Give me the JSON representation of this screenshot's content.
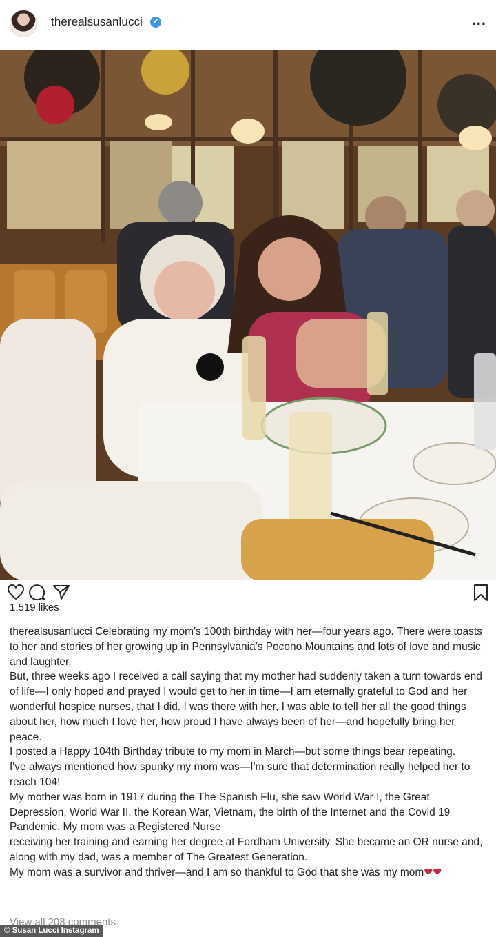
{
  "header": {
    "username": "therealsusanlucci",
    "verified_badge": "✔",
    "more_label": "..."
  },
  "post": {
    "likes": "1,519 likes",
    "caption_user": "therealsusanlucci",
    "caption_paragraphs": [
      "Celebrating my mom's 100th birthday with her—four years ago. There were toasts to her and stories of her growing up in Pennsylvania's Pocono Mountains and lots of love and music and laughter.",
      "But, three weeks ago I received a call saying that my mother had suddenly taken a turn towards end of life—I only hoped and prayed I would get to her in time—I am eternally grateful to God and her wonderful hospice nurses, that I did. I was there with her, I was able to tell her all the good things about her, how much I love her, how proud I have always been of her—and hopefully bring her peace.",
      "I posted a Happy 104th Birthday tribute to my mom in March—but some things bear repeating.",
      "I've always mentioned how spunky my mom was—I'm sure that determination really helped her to reach 104!",
      "My mother was born in 1917 during the The Spanish Flu, she saw World War I, the Great Depression, World War II, the Korean War, Vietnam, the birth of the Internet and the Covid 19 Pandemic. My mom was a Registered Nurse",
      "receiving her training and earning her degree at Fordham University. She became an OR nurse and, along with my dad, was a member of The Greatest Generation.",
      "My mom was a survivor and thriver—and I am so thankful to God that she was my mom"
    ],
    "caption_hearts": "❤❤",
    "view_comments": "View all 208 comments"
  },
  "credit": "© Susan Lucci Instagram",
  "icons": {
    "like": "heart-outline-icon",
    "comment": "comment-bubble-icon",
    "share": "paper-plane-icon",
    "save": "bookmark-icon"
  },
  "colors": {
    "verified": "#3897f0",
    "hearts": "#c0283c",
    "muted": "#8e8e8e"
  }
}
